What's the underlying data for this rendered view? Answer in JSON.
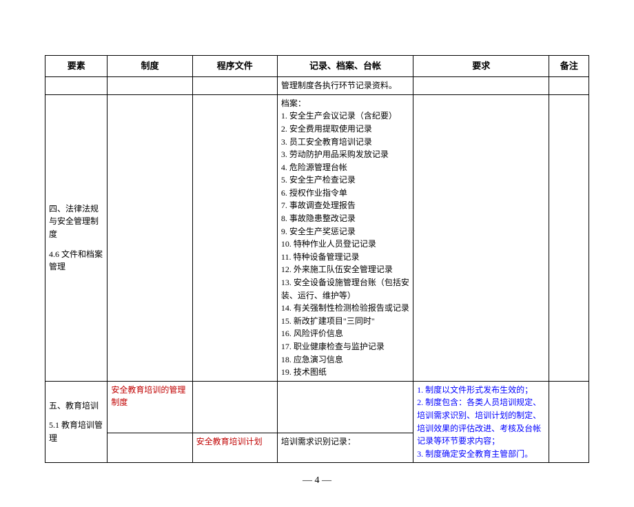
{
  "headers": {
    "factor": "要素",
    "system": "制度",
    "procedure": "程序文件",
    "records": "记录、档案、台帐",
    "requirements": "要求",
    "notes": "备注"
  },
  "rows": {
    "row1": {
      "records": "管理制度各执行环节记录资料。"
    },
    "row2": {
      "factor_a": "四、法律法规与安全管理制度",
      "factor_b": "4.6 文件和档案管理",
      "records_intro": "档案：",
      "records_list": [
        "1. 安全生产会议记录（含纪要）",
        "2. 安全费用提取使用记录",
        "3. 员工安全教育培训记录",
        "3. 劳动防护用品采购发放记录",
        "4. 危险源管理台帐",
        "5. 安全生产检查记录",
        "6. 授权作业指令单",
        "7. 事故调查处理报告",
        "8. 事故隐患整改记录",
        "9. 安全生产奖惩记录",
        "10. 特种作业人员登记记录",
        "11. 特种设备管理记录",
        "12. 外来施工队伍安全管理记录",
        "13. 安全设备设施管理台账（包括安装、运行、维护等）",
        "14. 有关强制性检测检验报告或记录",
        "15. 新改扩建项目\"三同时\"",
        "16. 风险评价信息",
        "17. 职业健康检查与监护记录",
        "18. 应急演习信息",
        "19. 技术图纸"
      ]
    },
    "row3": {
      "factor_a": "五、教育培训",
      "factor_b": "5.1 教育培训管理",
      "system": "安全教育培训的管理制度",
      "req1": "1. 制度以文件形式发布生效的；",
      "req2": "2. 制度包含：各类人员培训规定、培训需求识别、培训计划的制定、培训效果的评估改进、考核及台帐记录等环节要求内容；",
      "req3": "3. 制度确定安全教育主管部门。"
    },
    "row4": {
      "procedure": "安全教育培训计划",
      "records": "培训需求识别记录："
    }
  },
  "page_number": "— 4 —"
}
